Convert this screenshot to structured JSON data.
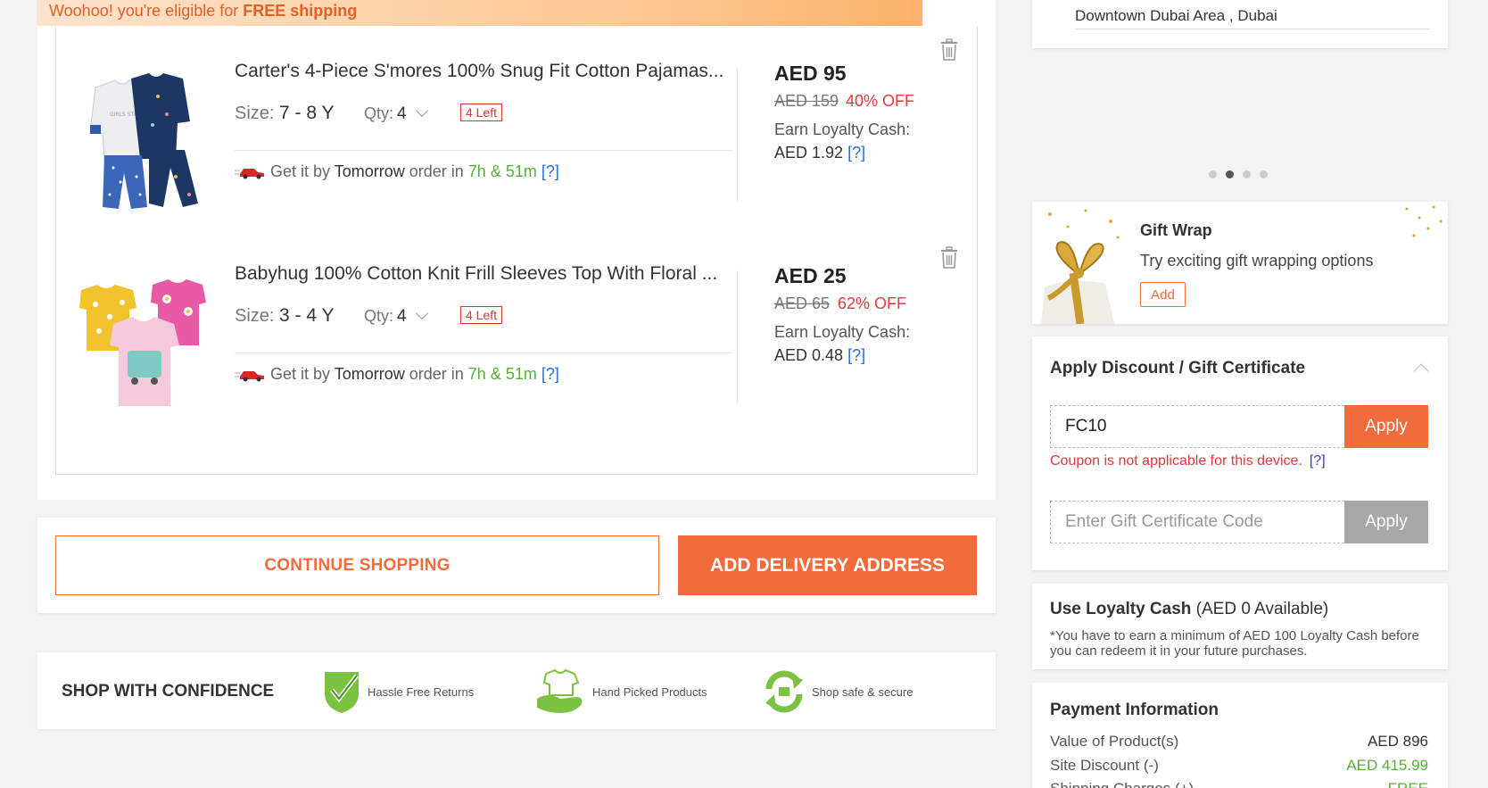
{
  "banner": {
    "text": "Woohoo! you're eligible for ",
    "bold": "FREE shipping"
  },
  "items": [
    {
      "title": "Carter's 4-Piece S'mores 100% Snug Fit Cotton Pajamas...",
      "size_label": "Size:",
      "size": "7 - 8 Y",
      "qty_label": "Qty:",
      "qty": "4",
      "stock": "4 Left",
      "delivery_prefix": "Get it by",
      "delivery_day": "Tomorrow",
      "delivery_mid": "order in",
      "delivery_time": "7h & 51m",
      "help": "[?]",
      "price": "AED 95",
      "mrp": "AED 159",
      "discount": "40% OFF",
      "loyalty_label": "Earn Loyalty Cash:",
      "loyalty_value": "AED 1.92"
    },
    {
      "title": "Babyhug 100% Cotton Knit Frill Sleeves Top With Floral ...",
      "size_label": "Size:",
      "size": "3 - 4 Y",
      "qty_label": "Qty:",
      "qty": "4",
      "stock": "4 Left",
      "delivery_prefix": "Get it by",
      "delivery_day": "Tomorrow",
      "delivery_mid": "order in",
      "delivery_time": "7h & 51m",
      "help": "[?]",
      "price": "AED 25",
      "mrp": "AED 65",
      "discount": "62% OFF",
      "loyalty_label": "Earn Loyalty Cash:",
      "loyalty_value": "AED 0.48"
    }
  ],
  "actions": {
    "continue": "CONTINUE SHOPPING",
    "address": "ADD DELIVERY ADDRESS"
  },
  "confidence": {
    "title": "SHOP WITH CONFIDENCE",
    "returns": "Hassle Free Returns",
    "picked": "Hand Picked Products",
    "secure": "Shop safe & secure"
  },
  "address": {
    "text": "Downtown Dubai Area , Dubai"
  },
  "gift": {
    "title": "Gift Wrap",
    "subtitle": "Try exciting gift wrapping options",
    "add": "Add"
  },
  "discount": {
    "title": "Apply Discount / Gift Certificate",
    "coupon_value": "FC10",
    "apply": "Apply",
    "error": "Coupon is not applicable for this device.",
    "help": "[?]",
    "gc_placeholder": "Enter Gift Certificate Code",
    "gc_apply": "Apply"
  },
  "loyalty": {
    "title": "Use Loyalty Cash",
    "available": " (AED 0 Available)",
    "note": "*You have to earn a minimum of AED 100 Loyalty Cash before you can redeem it in your future purchases."
  },
  "payment": {
    "title": "Payment Information",
    "rows": [
      {
        "label": "Value of Product(s)",
        "value": "AED 896"
      },
      {
        "label": "Site Discount (-)",
        "value": "AED 415.99"
      },
      {
        "label": "Shipping Charges (+)",
        "value": "FREE"
      }
    ]
  },
  "colors": {
    "accent": "#f26b3a",
    "green": "#56b13a",
    "error": "#e03a3a",
    "link": "#2a6fd6"
  }
}
